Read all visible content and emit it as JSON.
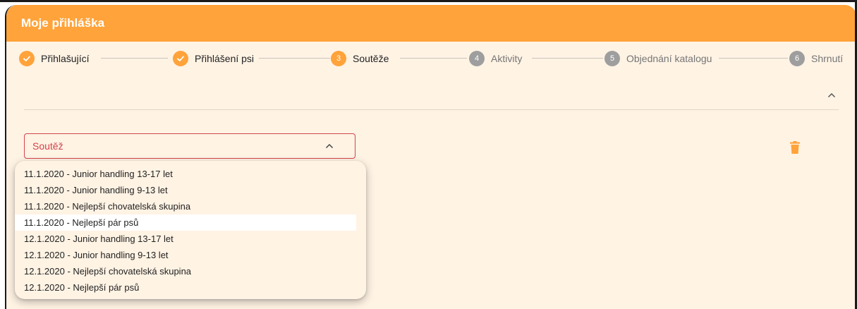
{
  "header": {
    "title": "Moje přihláška"
  },
  "stepper": {
    "steps": [
      {
        "label": "Přihlašující",
        "state": "done",
        "marker": "✓"
      },
      {
        "label": "Přihlášení psi",
        "state": "done",
        "marker": "✓"
      },
      {
        "label": "Soutěže",
        "state": "active",
        "marker": "3"
      },
      {
        "label": "Aktivity",
        "state": "todo",
        "marker": "4"
      },
      {
        "label": "Objednání katalogu",
        "state": "todo",
        "marker": "5"
      },
      {
        "label": "Shrnutí",
        "state": "todo",
        "marker": "6"
      }
    ]
  },
  "form": {
    "select_label": "Soutěž",
    "options": [
      "11.1.2020 - Junior handling 13-17 let",
      "11.1.2020 - Junior handling 9-13 let",
      "11.1.2020 - Nejlepší chovatelská skupina",
      "11.1.2020 - Nejlepší pár psů",
      "12.1.2020 - Junior handling 13-17 let",
      "12.1.2020 - Junior handling 9-13 let",
      "12.1.2020 - Nejlepší chovatelská skupina",
      "12.1.2020 - Nejlepší pár psů"
    ],
    "highlighted_option": "11.1.2020 - Nejlepší pár psů"
  },
  "colors": {
    "accent": "#ffa33a",
    "card_background": "#fff3e4",
    "error": "#d3434b",
    "inactive_step": "#9e9e9e"
  },
  "icons": [
    "check-icon",
    "chevron-up-icon",
    "trash-icon"
  ]
}
